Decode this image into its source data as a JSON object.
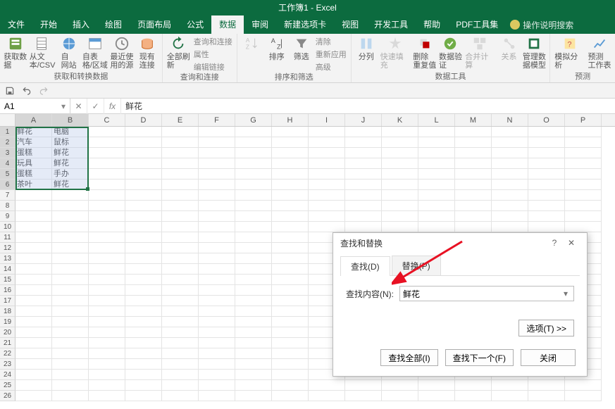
{
  "title": "工作簿1 - Excel",
  "tabs": [
    "文件",
    "开始",
    "插入",
    "绘图",
    "页面布局",
    "公式",
    "数据",
    "审阅",
    "新建选项卡",
    "视图",
    "开发工具",
    "帮助",
    "PDF工具集"
  ],
  "tell_me": "操作说明搜索",
  "active_tab": "数据",
  "ribbon_groups": {
    "get": {
      "label": "获取和转换数据",
      "btns": [
        "获取数\n据",
        "从文\n本/CSV",
        "自\n网站",
        "自表\n格/区域",
        "最近使\n用的源",
        "现有\n连接"
      ]
    },
    "query": {
      "label": "查询和连接",
      "main": "全部刷\n新",
      "sub": [
        "查询和连接",
        "属性",
        "编辑链接"
      ]
    },
    "sort": {
      "label": "排序和筛选",
      "btns": [
        "排序",
        "筛选"
      ],
      "sub": [
        "清除",
        "重新应用",
        "高级"
      ]
    },
    "tools": {
      "label": "数据工具",
      "btns": [
        "分列",
        "快速填充",
        "删除\n重复值",
        "数据验\n证",
        "合并计算",
        "关系",
        "管理数\n据模型"
      ]
    },
    "forecast": {
      "label": "预测",
      "btns": [
        "模拟分析",
        "预测\n工作表"
      ]
    }
  },
  "nameBox": "A1",
  "formula": "鲜花",
  "columns": [
    "A",
    "B",
    "C",
    "D",
    "E",
    "F",
    "G",
    "H",
    "I",
    "J",
    "K",
    "L",
    "M",
    "N",
    "O",
    "P"
  ],
  "rows": 26,
  "cells": {
    "1": [
      "鲜花",
      "电脑"
    ],
    "2": [
      "汽车",
      "鼠标"
    ],
    "3": [
      "蛋糕",
      "鲜花"
    ],
    "4": [
      "玩具",
      "鲜花"
    ],
    "5": [
      "蛋糕",
      "手办"
    ],
    "6": [
      "茶叶",
      "鲜花"
    ]
  },
  "dialog": {
    "title": "查找和替换",
    "tab_find": "查找(D)",
    "tab_replace": "替换(P)",
    "find_label": "查找内容(N):",
    "find_value": "鲜花",
    "options": "选项(T) >>",
    "find_all": "查找全部(I)",
    "find_next": "查找下一个(F)",
    "close": "关闭"
  }
}
